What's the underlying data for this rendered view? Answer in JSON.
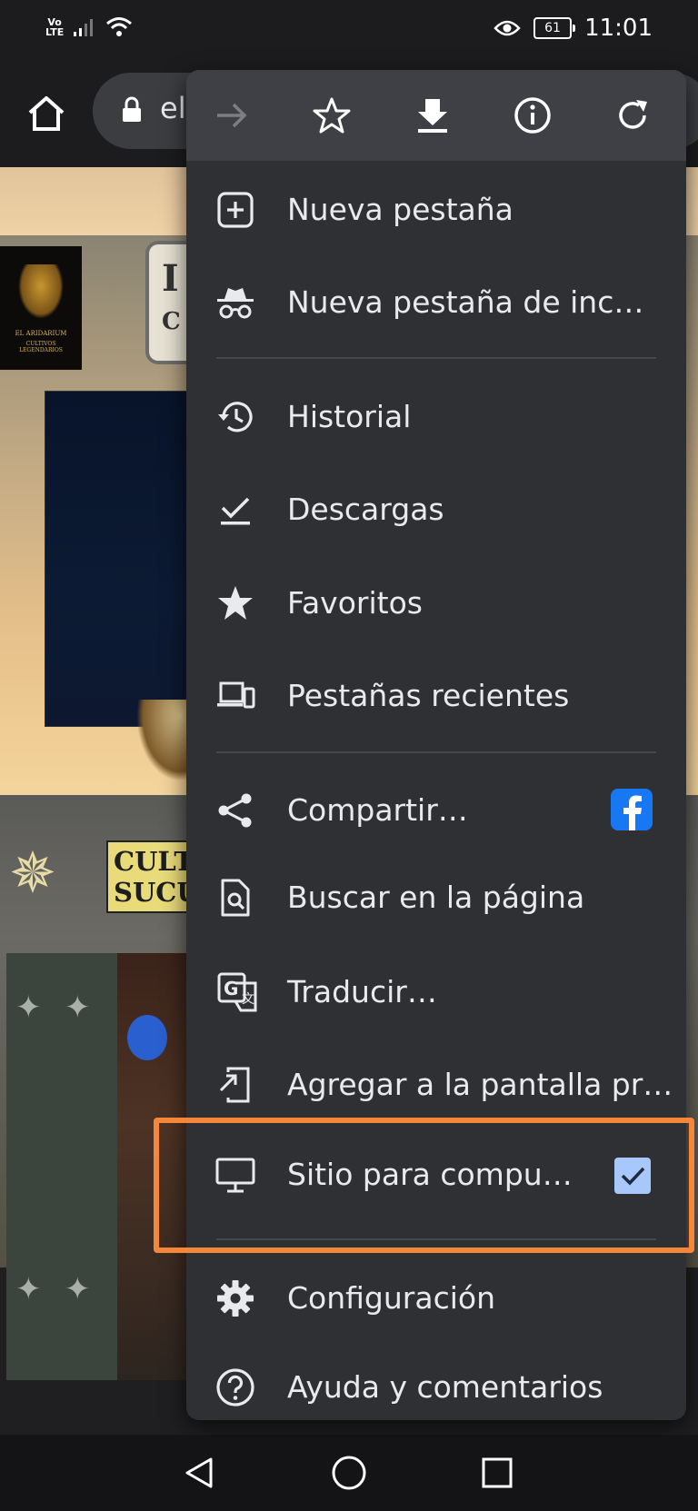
{
  "status_bar": {
    "volte_top": "Vo",
    "volte_bottom": "LTE",
    "battery": "61",
    "time": "11:01"
  },
  "toolbar": {
    "url_text": "el"
  },
  "web_content": {
    "logo_text_top": "EL ARIDARIUM",
    "logo_text_bottom": "CULTIVOS LEGENDARIOS",
    "plaque_line1": "I",
    "plaque_line2": "C",
    "cult_line1": "CULT",
    "cult_line2": "SUCU"
  },
  "menu": {
    "top_icons": [
      "forward-icon",
      "bookmark-star-icon",
      "download-icon",
      "info-icon",
      "refresh-icon"
    ],
    "items": [
      {
        "label": "Nueva pestaña",
        "icon": "new-tab-icon"
      },
      {
        "label": "Nueva pestaña de inc…",
        "icon": "incognito-icon"
      },
      {
        "label": "Historial",
        "icon": "history-icon"
      },
      {
        "label": "Descargas",
        "icon": "downloads-icon"
      },
      {
        "label": "Favoritos",
        "icon": "bookmarks-star-icon"
      },
      {
        "label": "Pestañas recientes",
        "icon": "devices-icon"
      },
      {
        "label": "Compartir…",
        "icon": "share-icon"
      },
      {
        "label": "Buscar en la página",
        "icon": "find-in-page-icon"
      },
      {
        "label": "Traducir…",
        "icon": "translate-icon"
      },
      {
        "label": "Agregar a la pantalla pr…",
        "icon": "add-to-home-icon"
      },
      {
        "label": "Sitio para compu…",
        "icon": "desktop-icon",
        "checked": true
      },
      {
        "label": "Configuración",
        "icon": "settings-icon"
      },
      {
        "label": "Ayuda y comentarios",
        "icon": "help-icon"
      }
    ]
  },
  "colors": {
    "menu_bg": "#2f3033",
    "menu_toolbar_bg": "#3f4045",
    "highlight": "#f5873a",
    "checkbox": "#a8c7fa",
    "facebook": "#1877f2"
  }
}
